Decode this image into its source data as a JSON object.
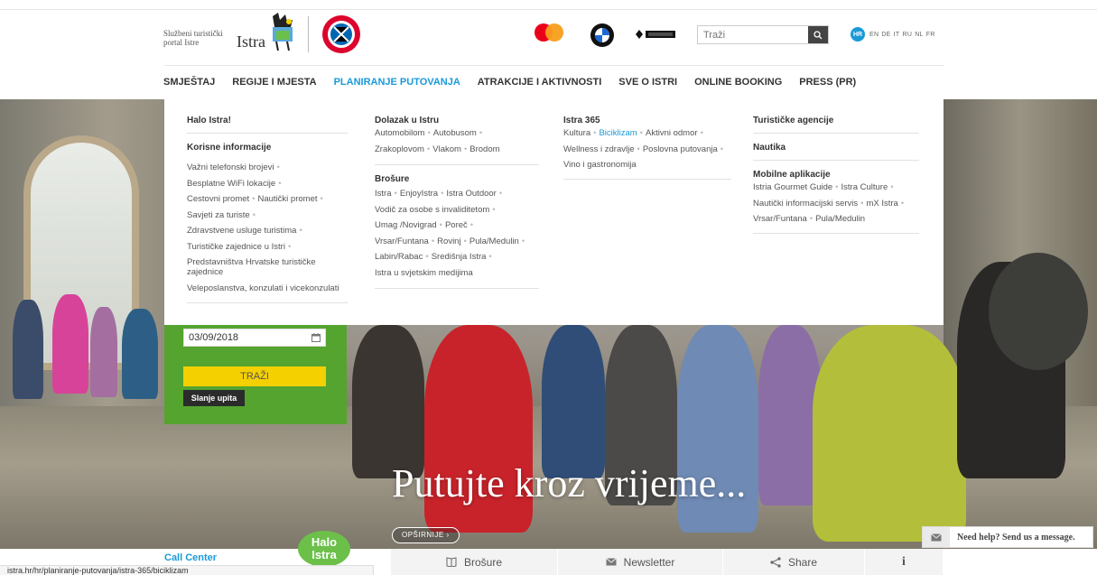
{
  "header": {
    "portal_text": "Službeni turistički portal Istre",
    "logo": "Istra",
    "search_placeholder": "Traži",
    "languages": [
      "EN",
      "DE",
      "IT",
      "RU",
      "NL",
      "FR"
    ],
    "active_language": "HR"
  },
  "nav": {
    "items": [
      "SMJEŠTAJ",
      "REGIJE I MJESTA",
      "PLANIRANJE PUTOVANJA",
      "ATRAKCIJE I AKTIVNOSTI",
      "SVE O ISTRI",
      "ONLINE BOOKING",
      "PRESS (PR)"
    ],
    "active_index": 2
  },
  "mega": {
    "col1": {
      "heading": "Halo Istra!",
      "subheading": "Korisne informacije",
      "links": [
        "Važni telefonski brojevi",
        "Besplatne WiFi lokacije",
        "Cestovni promet",
        "Nautički promet",
        "Savjeti za turiste",
        "Zdravstvene usluge turistima",
        "Turističke zajednice u Istri",
        "Predstavništva Hrvatske turističke zajednice",
        "Veleposlanstva, konzulati i vicekonzulati"
      ]
    },
    "col2": {
      "heading": "Dolazak u Istru",
      "links1": [
        "Automobilom",
        "Autobusom",
        "Zrakoplovom",
        "Vlakom",
        "Brodom"
      ],
      "subheading": "Brošure",
      "links2": [
        "Istra",
        "EnjoyIstra",
        "Istra Outdoor",
        "Vodič za osobe s invaliditetom",
        "Umag /Novigrad",
        "Poreč",
        "Vrsar/Funtana",
        "Rovinj",
        "Pula/Medulin",
        "Labin/Rabac",
        "Središnja Istra",
        "Istra u svjetskim medijima"
      ]
    },
    "col3": {
      "heading": "Istra 365",
      "links": [
        "Kultura",
        "Biciklizam",
        "Aktivni odmor",
        "Wellness i zdravlje",
        "Poslovna putovanja",
        "Vino i gastronomija"
      ]
    },
    "col4": {
      "heading1": "Turističke agencije",
      "heading2": "Nautika",
      "heading3": "Mobilne aplikacije",
      "links": [
        "Istria Gourmet Guide",
        "Istra Culture",
        "Nautički informacijski servis",
        "mX Istra",
        "Vrsar/Funtana",
        "Pula/Medulin"
      ]
    }
  },
  "booking": {
    "date": "03/09/2018",
    "search_button": "TRAŽI",
    "inquiry_button": "Slanje upita"
  },
  "hero": {
    "title": "Putujte kroz vrijeme...",
    "more_button": "OPŠIRNIJE"
  },
  "bottom": {
    "call_center": "Call Center",
    "halo_line1": "Halo",
    "halo_line2": "Istra",
    "brochures": "Brošure",
    "newsletter": "Newsletter",
    "share": "Share",
    "info": "i",
    "status_url": "istra.hr/hr/planiranje-putovanja/istra-365/biciklizam",
    "chat": "Need help? Send us a message."
  },
  "colors": {
    "accent": "#1a9ad8",
    "booking_green": "#54a42f",
    "button_yellow": "#f5d000"
  }
}
